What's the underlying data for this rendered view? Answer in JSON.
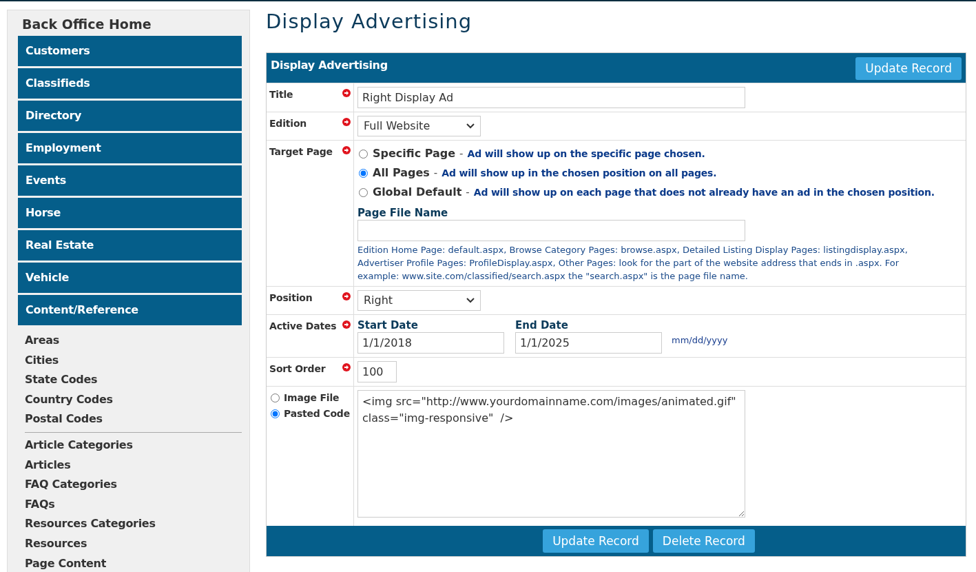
{
  "sidebar": {
    "title": "Back Office Home",
    "sections": [
      "Customers",
      "Classifieds",
      "Directory",
      "Employment",
      "Events",
      "Horse",
      "Real Estate",
      "Vehicle",
      "Content/Reference"
    ],
    "link_groups": [
      [
        "Areas",
        "Cities",
        "State Codes",
        "Country Codes",
        "Postal Codes"
      ],
      [
        "Article Categories",
        "Articles",
        "FAQ Categories",
        "FAQs",
        "Resources Categories",
        "Resources",
        "Page Content"
      ]
    ]
  },
  "page_title": "Display Advertising",
  "form": {
    "title": "Display Advertising",
    "header_button": "Update Record",
    "rows": [
      {
        "kind": "text",
        "label": "Title",
        "required": true,
        "value": "Right Display Ad"
      },
      {
        "kind": "select",
        "label": "Edition",
        "required": true,
        "value": "Full Website"
      },
      {
        "kind": "radios",
        "label": "Target Page",
        "required": true,
        "options": [
          {
            "label": "Specific Page",
            "separator": "-",
            "description": "Ad will show up on the specific page chosen.",
            "selected": false
          },
          {
            "label": "All Pages",
            "separator": "-",
            "description": "Ad will show up in the chosen position on all pages.",
            "selected": true
          },
          {
            "label": "Global Default",
            "separator": "-",
            "description": "Ad will show up on each page that does not already have an ad in the chosen position.",
            "selected": false
          }
        ],
        "file_label": "Page File Name",
        "file_help": "Edition Home Page: default.aspx, Browse Category Pages: browse.aspx, Detailed Listing Display Pages: listingdisplay.aspx, Advertiser Profile Pages: ProfileDisplay.aspx, Other Pages: look for the part of the website address that ends in .aspx. For example: www.site.com/classified/search.aspx the \"search.aspx\" is the page file name."
      },
      {
        "kind": "select",
        "label": "Position",
        "required": true,
        "value": "Right"
      },
      {
        "kind": "dates",
        "label": "Active Dates",
        "required": true,
        "fields": [
          {
            "label": "Start Date",
            "value": "1/1/2018"
          },
          {
            "label": "End Date",
            "value": "1/1/2025"
          }
        ],
        "hint": "mm/dd/yyyy"
      },
      {
        "kind": "short",
        "label": "Sort Order",
        "required": true,
        "value": "100"
      },
      {
        "kind": "code",
        "choices": [
          {
            "label": "Image File",
            "selected": false
          },
          {
            "label": "Pasted Code",
            "selected": true
          }
        ],
        "value": "<img src=\"http://www.yourdomainname.com/images/animated.gif\" class=\"img-responsive\"  />"
      }
    ],
    "footer_buttons": [
      "Update Record",
      "Delete Record"
    ]
  }
}
